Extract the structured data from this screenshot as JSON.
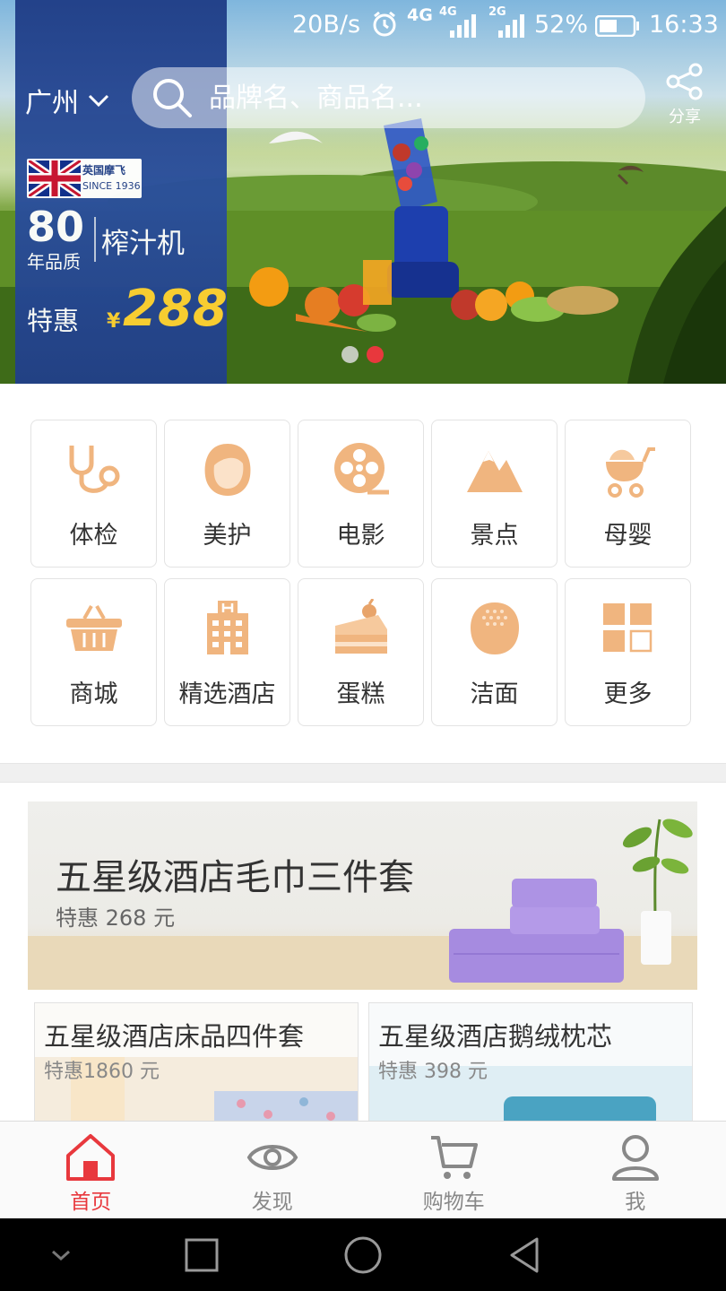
{
  "status_bar": {
    "speed": "20B/s",
    "network1": "4G",
    "network2": "4G",
    "network3": "2G",
    "battery": "52%",
    "time": "16:33"
  },
  "header": {
    "city": "广州",
    "search_placeholder": "品牌名、商品名...",
    "share_label": "分享"
  },
  "banner": {
    "brand_cn": "英国摩飞",
    "brand_since": "SINCE 1936",
    "years_number": "80",
    "years_text": "年品质",
    "product": "榨汁机",
    "tehui": "特惠",
    "currency": "¥",
    "price": "288",
    "dots_total": 2,
    "dot_active": 2
  },
  "categories": [
    {
      "label": "体检",
      "icon": "stethoscope-icon"
    },
    {
      "label": "美护",
      "icon": "face-icon"
    },
    {
      "label": "电影",
      "icon": "film-reel-icon"
    },
    {
      "label": "景点",
      "icon": "mountain-icon"
    },
    {
      "label": "母婴",
      "icon": "stroller-icon"
    },
    {
      "label": "商城",
      "icon": "basket-icon"
    },
    {
      "label": "精选酒店",
      "icon": "hotel-icon"
    },
    {
      "label": "蛋糕",
      "icon": "cake-icon"
    },
    {
      "label": "洁面",
      "icon": "cleanser-icon"
    },
    {
      "label": "更多",
      "icon": "more-grid-icon"
    }
  ],
  "promos": {
    "main": {
      "title": "五星级酒店毛巾三件套",
      "price": "特惠 268 元"
    },
    "sub": [
      {
        "title": "五星级酒店床品四件套",
        "price": "特惠1860 元"
      },
      {
        "title": "五星级酒店鹅绒枕芯",
        "price": "特惠 398 元"
      }
    ]
  },
  "tabs": [
    {
      "label": "首页",
      "icon": "home-icon",
      "active": true
    },
    {
      "label": "发现",
      "icon": "eye-icon",
      "active": false
    },
    {
      "label": "购物车",
      "icon": "cart-icon",
      "active": false
    },
    {
      "label": "我",
      "icon": "user-icon",
      "active": false
    }
  ],
  "colors": {
    "accent": "#e8383d",
    "icon_orange": "#f0b57f",
    "banner_panel": "#1f3d86",
    "price_yellow": "#ffd233"
  }
}
